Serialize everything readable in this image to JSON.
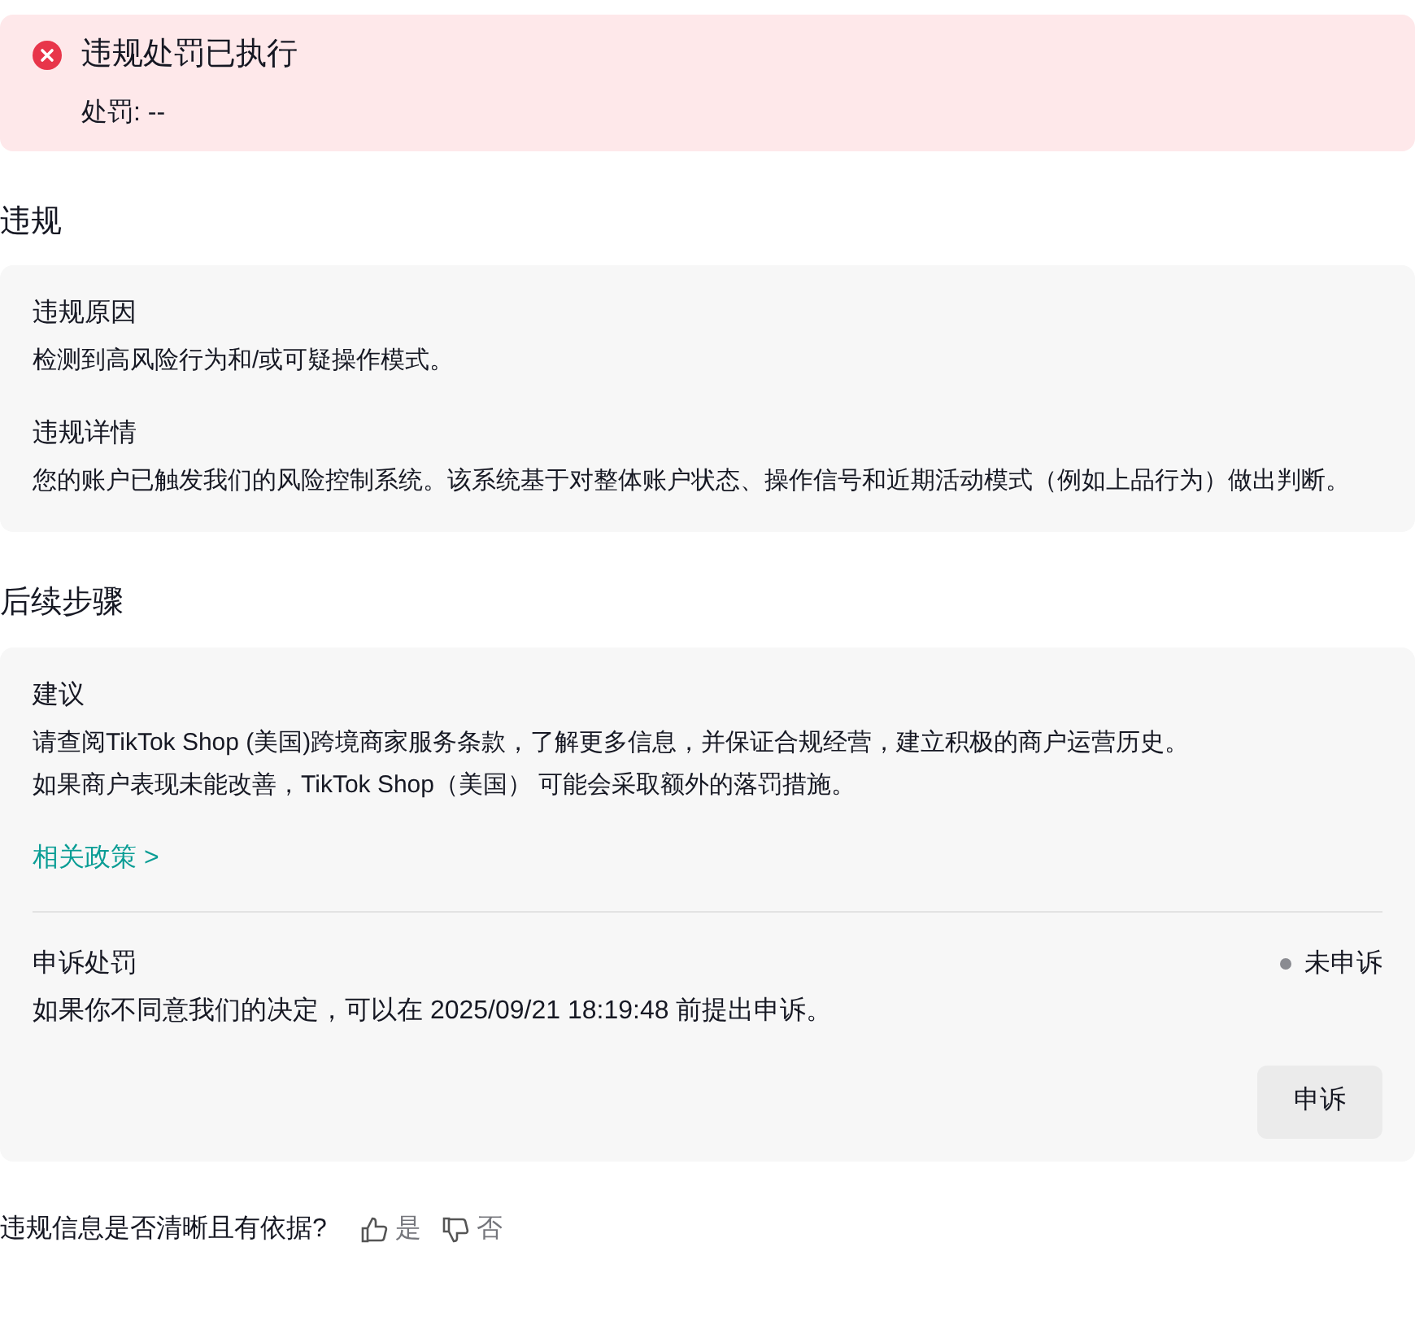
{
  "alert": {
    "title": "违规处罚已执行",
    "detail": "处罚: --"
  },
  "violation": {
    "heading": "违规",
    "items": [
      {
        "label": "违规原因",
        "text": "检测到高风险行为和/或可疑操作模式。"
      },
      {
        "label": "违规详情",
        "text": "您的账户已触发我们的风险控制系统。该系统基于对整体账户状态、操作信号和近期活动模式（例如上品行为）做出判断。"
      }
    ]
  },
  "next_steps": {
    "heading": "后续步骤",
    "suggestion_label": "建议",
    "suggestion_lines": [
      "请查阅TikTok Shop (美国)跨境商家服务条款，了解更多信息，并保证合规经营，建立积极的商户运营历史。",
      "如果商户表现未能改善，TikTok Shop（美国） 可能会采取额外的落罚措施。"
    ],
    "policy_link": "相关政策 >",
    "appeal": {
      "label": "申诉处罚",
      "status": "未申诉",
      "text": "如果你不同意我们的决定，可以在 2025/09/21 18:19:48 前提出申诉。",
      "button": "申诉"
    }
  },
  "feedback": {
    "question": "违规信息是否清晰且有依据?",
    "yes": "是",
    "no": "否"
  }
}
